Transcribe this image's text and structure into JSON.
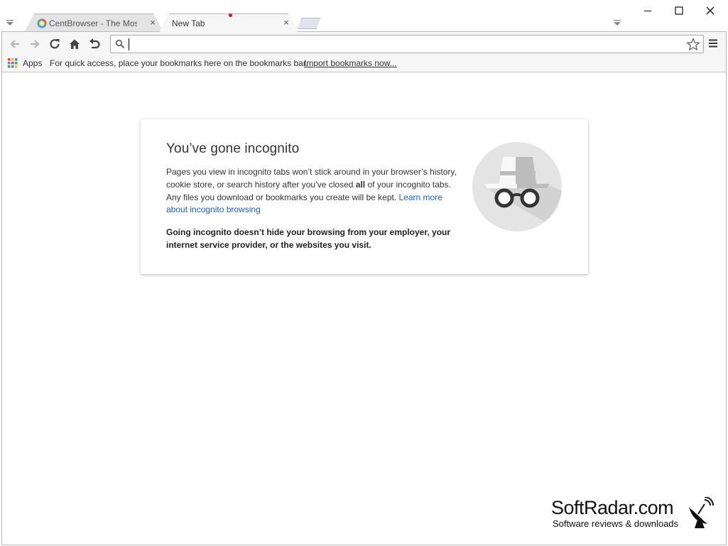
{
  "tabs": [
    {
      "title": "CentBrowser - The Most F",
      "close": "×"
    },
    {
      "title": "New Tab",
      "close": "×"
    }
  ],
  "omnibox": {
    "value": "",
    "placeholder": ""
  },
  "bookmarks": {
    "apps_label": "Apps",
    "hint": "For quick access, place your bookmarks here on the bookmarks bar.",
    "import_link": "Import bookmarks now..."
  },
  "incognito": {
    "title": "You’ve gone incognito",
    "body_part1": "Pages you view in incognito tabs won’t stick around in your browser’s history, cookie store, or search history after you’ve closed ",
    "body_bold": "all",
    "body_part2": " of your incognito tabs. Any files you download or bookmarks you create will be kept. ",
    "learn_more": "Learn more about incognito browsing",
    "warning": "Going incognito doesn’t hide your browsing from your employer, your internet service provider, or the websites you visit."
  },
  "watermark": {
    "title": "SoftRadar.com",
    "subtitle": "Software reviews & downloads"
  },
  "colors": {
    "link": "#1a5ed1",
    "recording_dot": "#e81010",
    "incognito_bg": "#e4e4e4"
  }
}
